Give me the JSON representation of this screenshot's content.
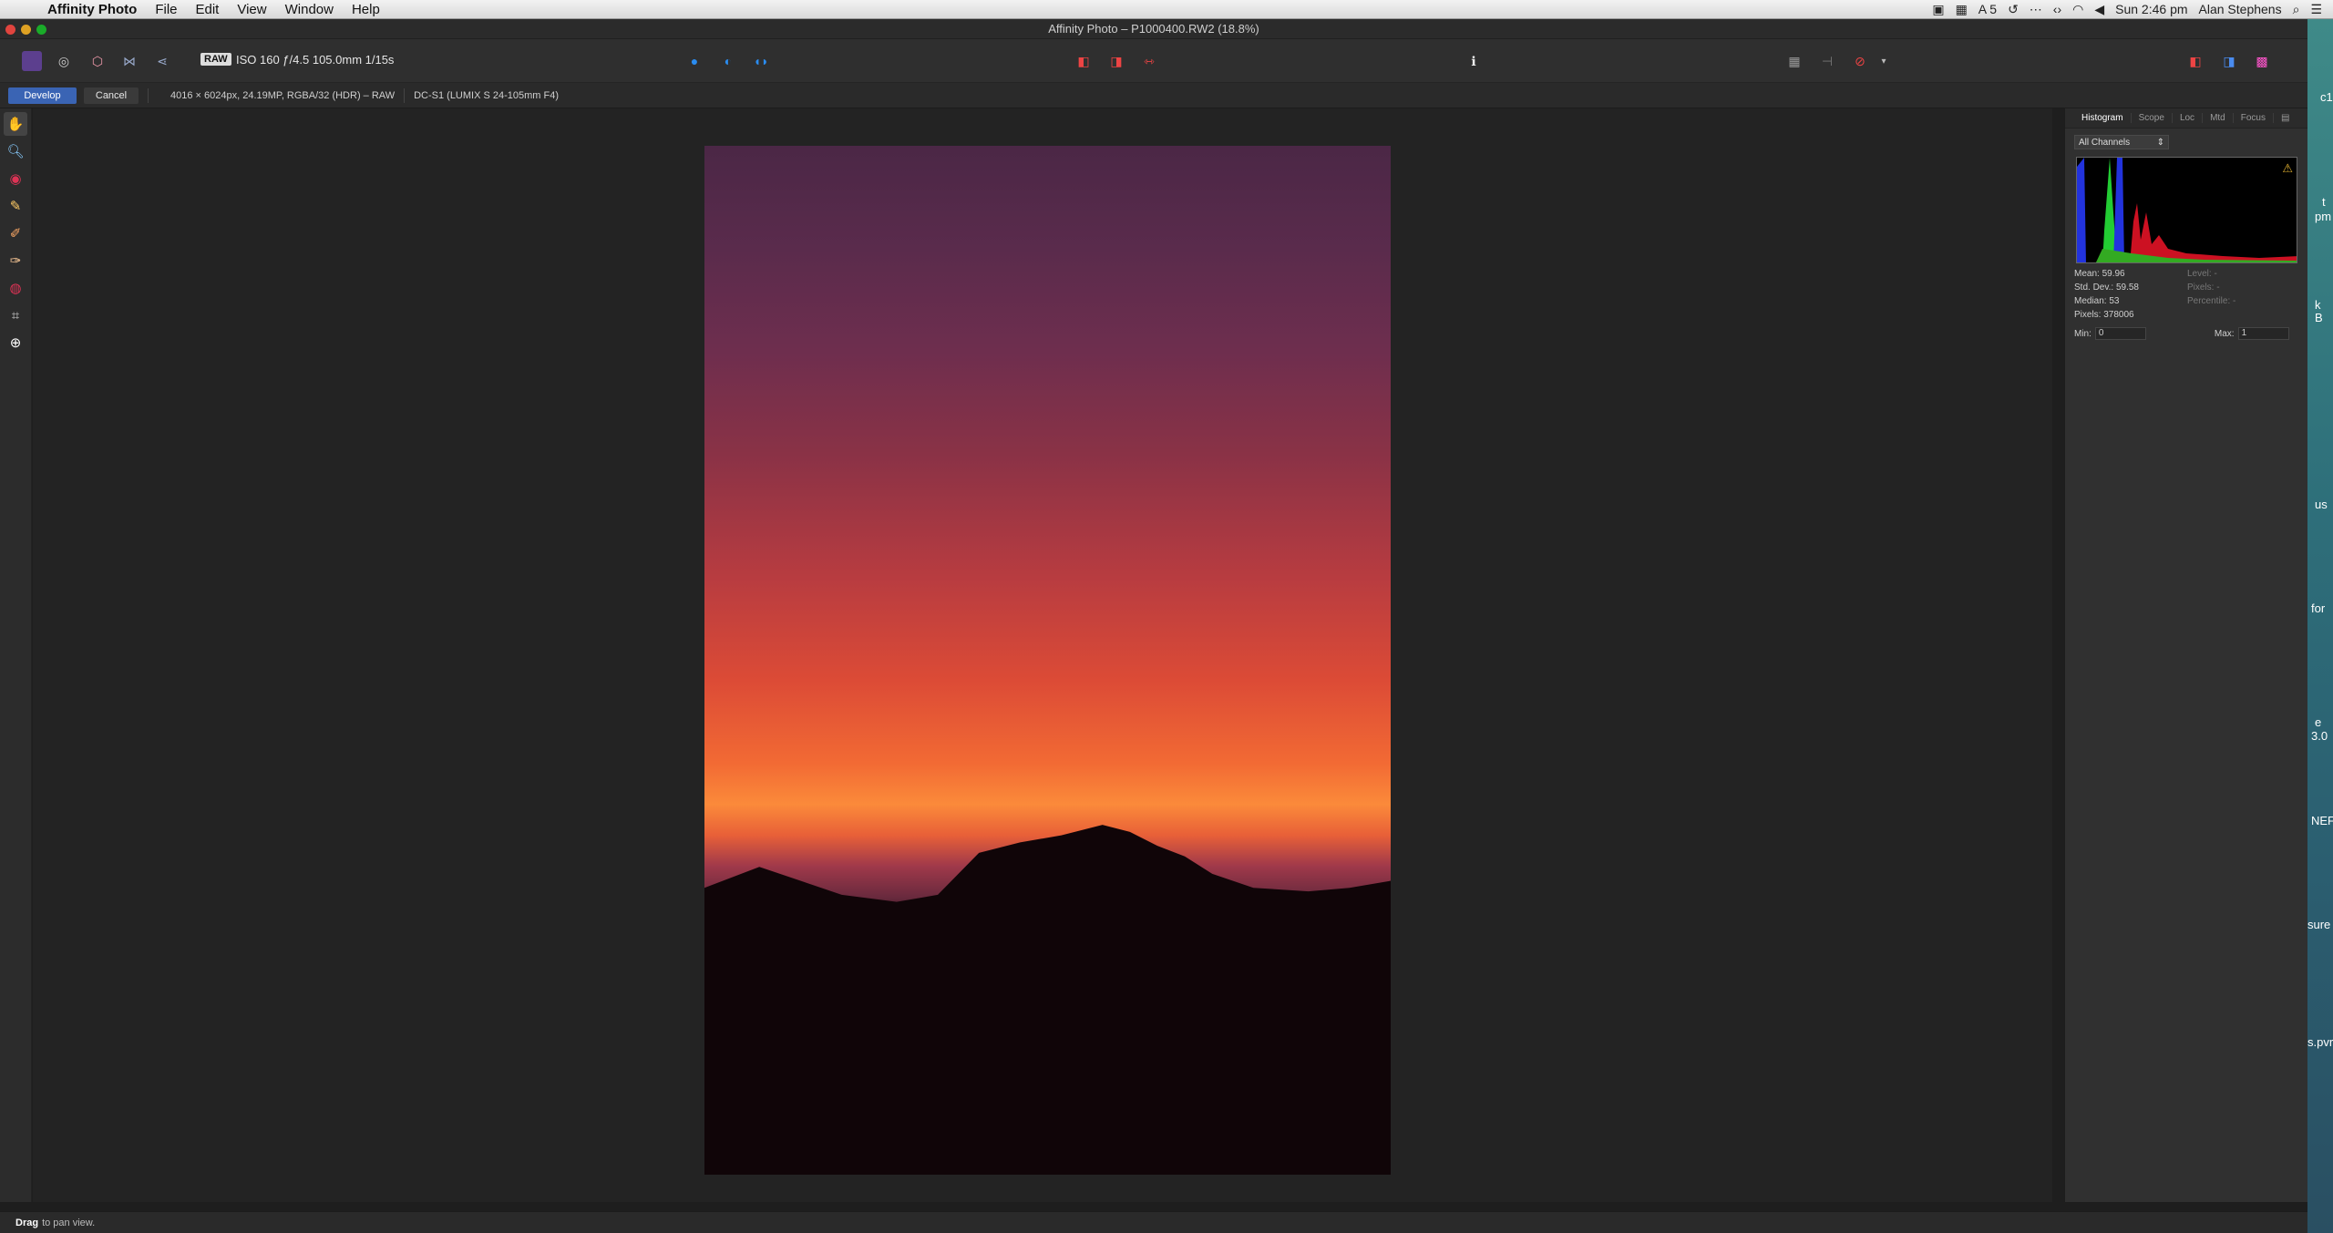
{
  "menubar": {
    "app": "Affinity Photo",
    "menus": [
      "File",
      "Edit",
      "View",
      "Window",
      "Help"
    ],
    "badge_count": "5",
    "clock": "Sun 2:46 pm",
    "user": "Alan Stephens"
  },
  "window": {
    "title": "Affinity Photo – P1000400.RW2 (18.8%)"
  },
  "toolbar": {
    "raw_badge": "RAW",
    "exif": "ISO 160 ƒ/4.5 105.0mm 1/15s"
  },
  "context": {
    "develop_label": "Develop",
    "cancel_label": "Cancel",
    "image_info": "4016 × 6024px, 24.19MP, RGBA/32 (HDR) – RAW",
    "lens_info": "DC-S1 (LUMIX S 24-105mm F4)"
  },
  "panel": {
    "tabs": [
      "Histogram",
      "Scope",
      "Loc",
      "Mtd",
      "Focus"
    ],
    "channel": "All Channels",
    "stats_left": [
      "Mean: 59.96",
      "Std. Dev.: 59.58",
      "Median: 53",
      "Pixels: 378006"
    ],
    "stats_right": [
      "Level: -",
      "Pixels: -",
      "Percentile: -"
    ],
    "min_label": "Min:",
    "min_value": "0",
    "max_label": "Max:",
    "max_value": "1"
  },
  "desktop_fragments": [
    "c1",
    "t",
    "pm",
    "k",
    "B",
    "us",
    "for",
    "e",
    "3.0",
    "NEF",
    "sure",
    "s.pvr"
  ],
  "status": {
    "bold": "Drag",
    "text": "to pan view."
  },
  "icons": {
    "tools": [
      "hand-icon",
      "zoom-icon",
      "red-eye-icon",
      "blemish-icon",
      "overlay-paint-icon",
      "overlay-erase-icon",
      "overlay-gradient-icon",
      "crop-icon",
      "white-balance-picker-icon"
    ]
  }
}
